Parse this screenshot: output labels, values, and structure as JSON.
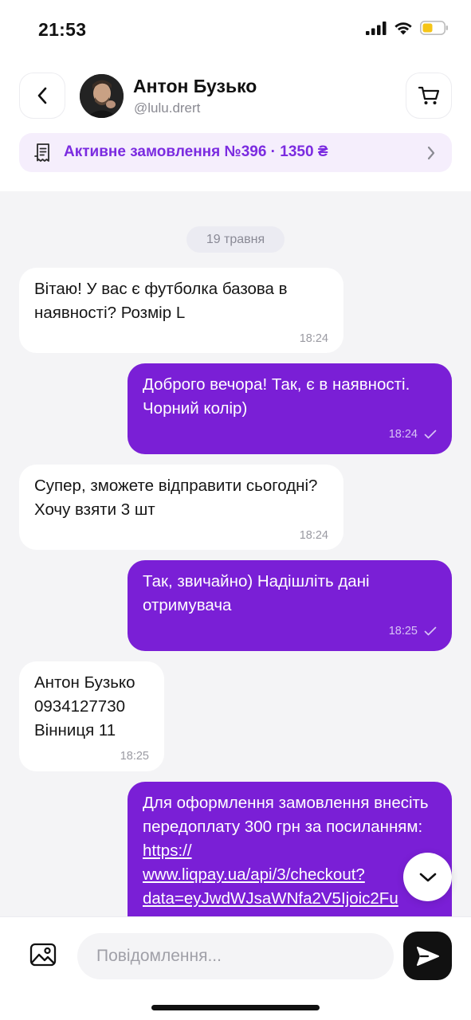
{
  "status_bar": {
    "time": "21:53",
    "icons": [
      "signal-icon",
      "wifi-icon",
      "battery-icon"
    ],
    "battery_color": "#f5c518"
  },
  "header": {
    "back_icon": "chevron-left-icon",
    "contact_name": "Антон Бузько",
    "contact_handle": "@lulu.drert",
    "cart_icon": "cart-icon"
  },
  "order_banner": {
    "icon": "receipt-icon",
    "text": "Активне замовлення №396 · 1350 ₴",
    "chevron_icon": "chevron-right-icon",
    "accent_color": "#7b2be0"
  },
  "chat": {
    "date_label": "19 травня",
    "messages": [
      {
        "direction": "in",
        "text": "Вітаю! У вас є футболка базова в наявності? Розмір L",
        "time": "18:24"
      },
      {
        "direction": "out",
        "text": "Доброго вечора! Так, є в наявності. Чорний колір)",
        "time": "18:24",
        "status_icon": "check-icon"
      },
      {
        "direction": "in",
        "text": "Супер, зможете відправити сьогодні? Хочу взяти 3 шт",
        "time": "18:24"
      },
      {
        "direction": "out",
        "text": "Так, звичайно) Надішліть дані отримувача",
        "time": "18:25",
        "status_icon": "check-icon"
      },
      {
        "direction": "in",
        "text": "Антон Бузько\n0934127730\nВінниця 11",
        "time": "18:25"
      },
      {
        "direction": "out",
        "text": "Для оформлення замовлення внесіть передоплату 300 грн за посиланням:",
        "link_parts": [
          "https://",
          "www.liqpay.ua/api/3/checkout?",
          "data=eyJwdWJsaWNfa2V5Ijoic2Fu"
        ]
      }
    ],
    "scroll_down_icon": "chevron-down-icon",
    "outgoing_color": "#7a1fd6"
  },
  "composer": {
    "gallery_icon": "image-icon",
    "placeholder": "Повідомлення...",
    "value": "",
    "send_icon": "send-icon"
  }
}
